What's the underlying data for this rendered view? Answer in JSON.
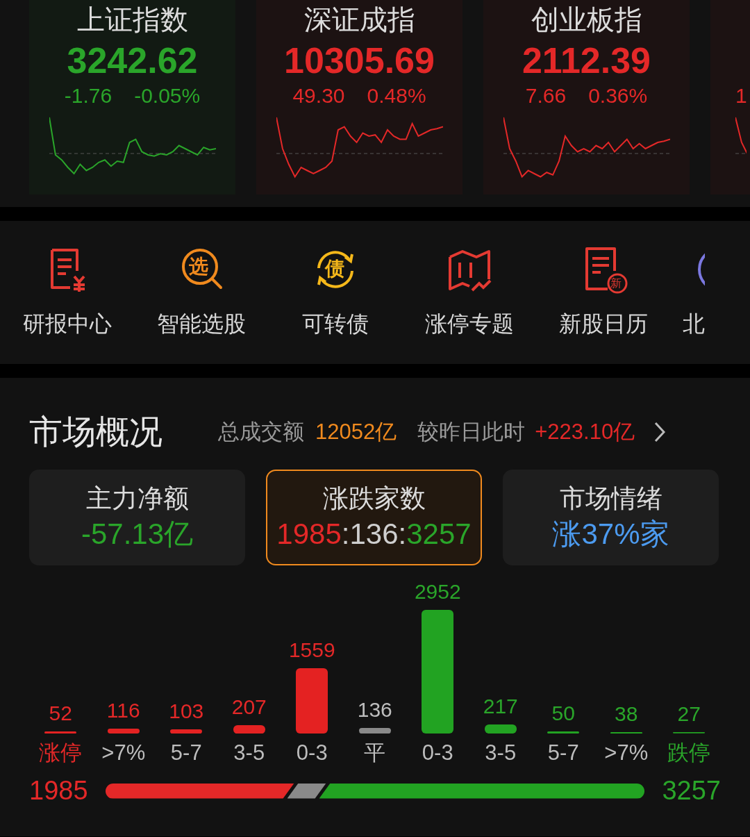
{
  "indices": [
    {
      "name": "上证指数",
      "value": "3242.62",
      "change": "-1.76",
      "percent": "-0.05%",
      "kind": "down"
    },
    {
      "name": "深证成指",
      "value": "10305.69",
      "change": "49.30",
      "percent": "0.48%",
      "kind": "up"
    },
    {
      "name": "创业板指",
      "value": "2112.39",
      "change": "7.66",
      "percent": "0.36%",
      "kind": "up"
    },
    {
      "change": "1",
      "kind": "up"
    }
  ],
  "shortcuts": [
    {
      "label": "研报中心",
      "kind": "report"
    },
    {
      "label": "智能选股",
      "kind": "select",
      "icon_text": "选"
    },
    {
      "label": "可转债",
      "kind": "bond",
      "icon_text": "债"
    },
    {
      "label": "涨停专题",
      "kind": "limit"
    },
    {
      "label": "新股日历",
      "kind": "ipo",
      "icon_text": "新"
    },
    {
      "label": "北",
      "kind": "north"
    }
  ],
  "market": {
    "title": "市场概况",
    "turnover_label": "总成交额",
    "turnover": "12052亿",
    "compare_label": "较昨日此时",
    "compare": "+223.10亿",
    "cards": [
      {
        "title": "主力净额",
        "selected": false,
        "parts": [
          {
            "text": "-57.13亿",
            "kind": "down"
          }
        ]
      },
      {
        "title": "涨跌家数",
        "selected": true,
        "parts": [
          {
            "text": "1985",
            "kind": "up"
          },
          {
            "text": ":",
            "kind": "neutral"
          },
          {
            "text": "136",
            "kind": "neutral"
          },
          {
            "text": ":",
            "kind": "neutral"
          },
          {
            "text": "3257",
            "kind": "down"
          }
        ]
      },
      {
        "title": "市场情绪",
        "selected": false,
        "parts": [
          {
            "text": "涨37%家",
            "kind": "info"
          }
        ]
      }
    ],
    "distribution": {
      "bars": [
        {
          "kind": "up",
          "limit": true
        },
        {
          "kind": "up",
          "limit": false
        },
        {
          "kind": "up",
          "limit": false
        },
        {
          "kind": "up",
          "limit": false
        },
        {
          "kind": "up",
          "limit": false
        },
        {
          "kind": "flat",
          "limit": false
        },
        {
          "kind": "down",
          "limit": false
        },
        {
          "kind": "down",
          "limit": false
        },
        {
          "kind": "down",
          "limit": false
        },
        {
          "kind": "down",
          "limit": false
        },
        {
          "kind": "down",
          "limit": true
        }
      ],
      "chart_data": {
        "type": "bar",
        "categories": [
          "涨停",
          ">7%",
          "5-7",
          "3-5",
          "0-3",
          "平",
          "0-3",
          "3-5",
          "5-7",
          ">7%",
          "跌停"
        ],
        "data_labels": true,
        "values": [
          52,
          116,
          103,
          207,
          1559,
          136,
          2952,
          217,
          50,
          38,
          27
        ]
      }
    },
    "ratio": {
      "up": "1985",
      "down": "3257",
      "level": 0.35
    }
  }
}
